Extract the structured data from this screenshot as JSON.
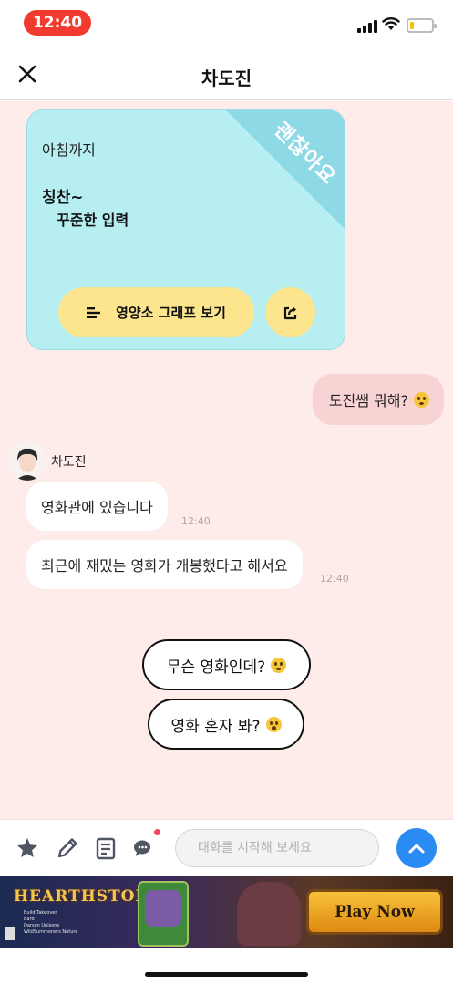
{
  "status_bar": {
    "time": "12:40"
  },
  "header": {
    "title": "차도진"
  },
  "card": {
    "line1": "아침까지",
    "praise": "칭찬~",
    "detail": "꾸준한 입력",
    "ribbon": "괜찮아요",
    "graph_button": "영양소 그래프 보기"
  },
  "messages": {
    "mine": "도진쌤 뭐해?",
    "sender_name": "차도진",
    "received": [
      {
        "text": "영화관에 있습니다",
        "time": "12:40"
      },
      {
        "text": "최근에 재밌는 영화가 개봉했다고 해서요",
        "time": "12:40"
      }
    ]
  },
  "quick_replies": [
    "무슨 영화인데?",
    "영화 혼자 봐?"
  ],
  "input": {
    "placeholder": "대화를 시작해 보세요"
  },
  "ad": {
    "logo": "HEARTHSTONE",
    "small_text": [
      "Build Takeover",
      "Bard",
      "Darson Unisons",
      "WildSummoners Nature"
    ],
    "button": "Play Now"
  },
  "colors": {
    "chat_background": "#fdecea",
    "card_background": "#b6eef2",
    "button_yellow": "#fce58c",
    "my_bubble": "#f8d3d3",
    "send_button": "#2a8bf2",
    "time_pill": "#f23b30"
  }
}
